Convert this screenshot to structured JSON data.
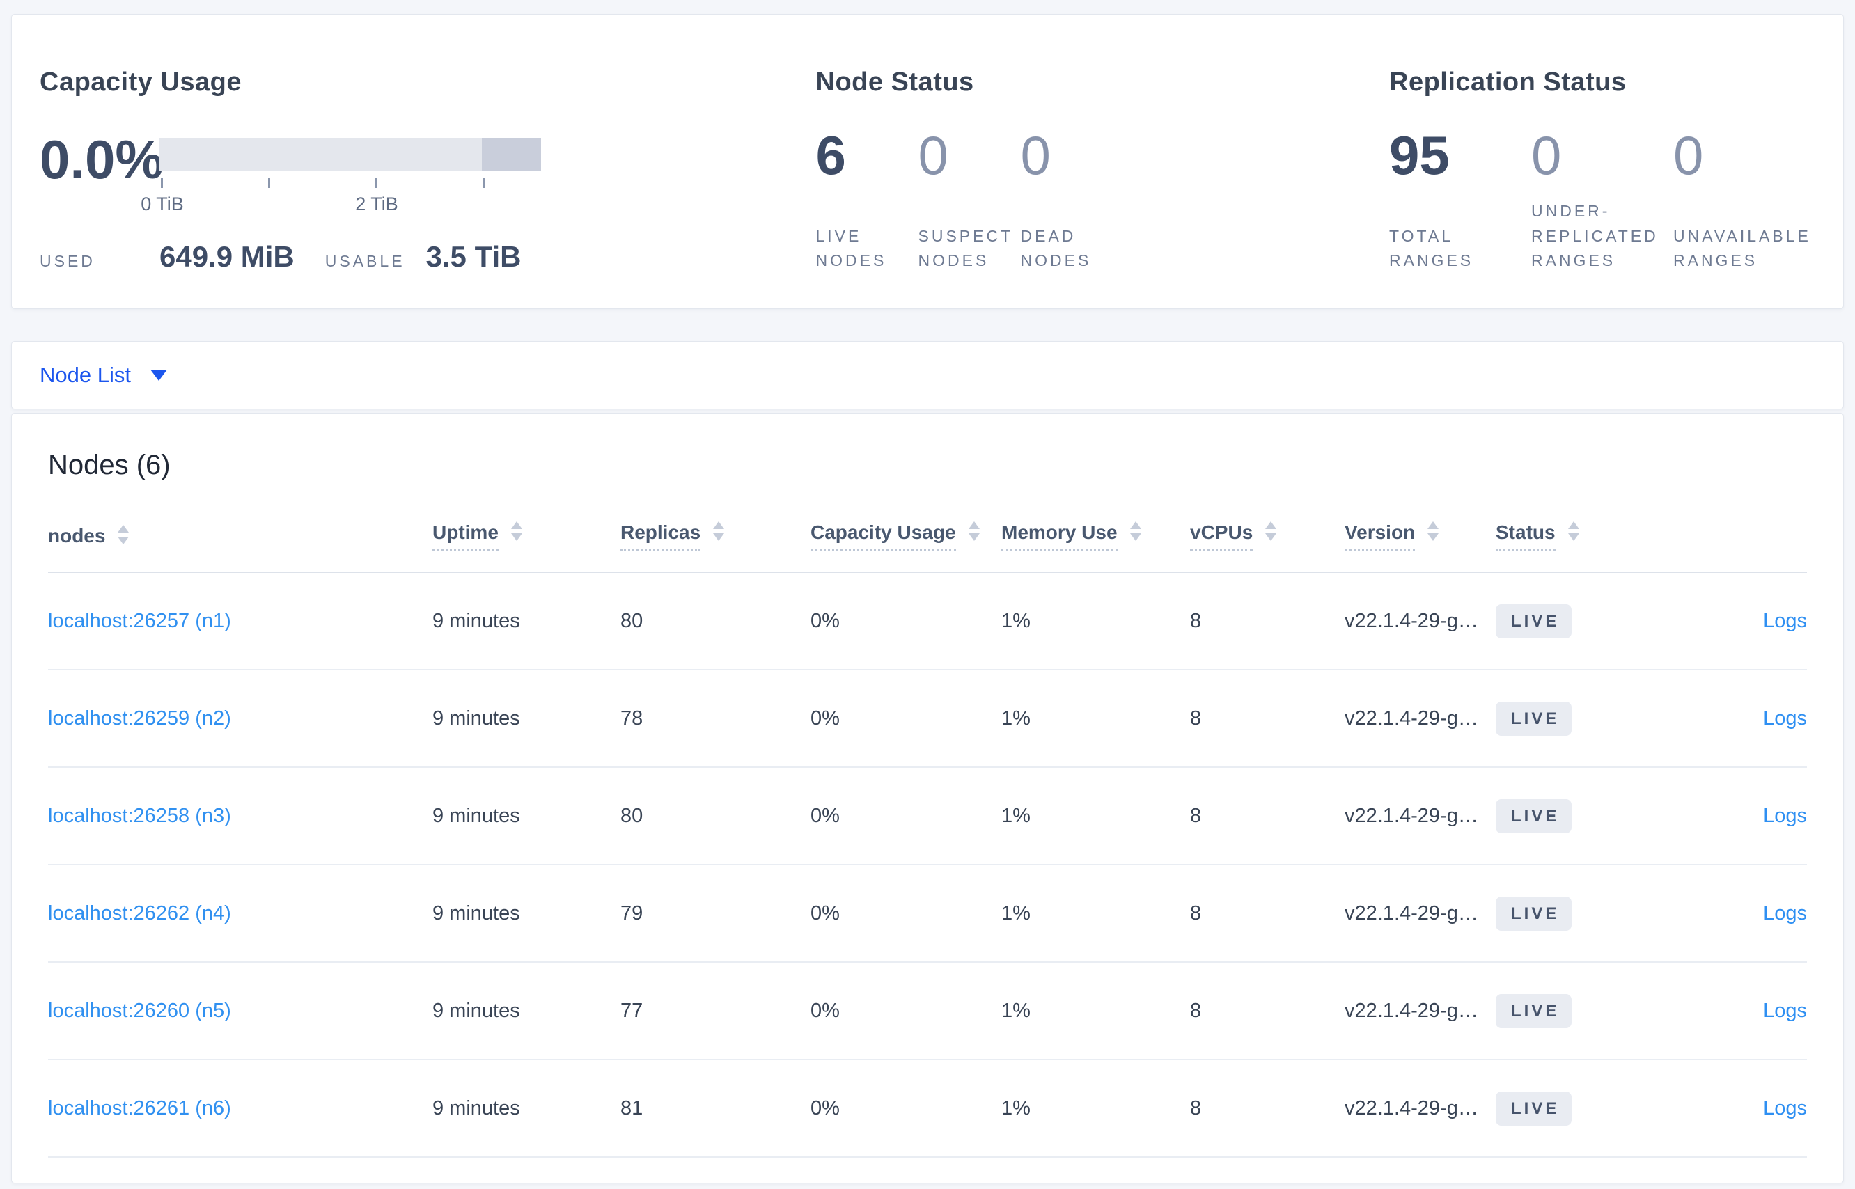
{
  "overview": {
    "capacity": {
      "title": "Capacity Usage",
      "percent": "0.0%",
      "axis_ticks": [
        "0 TiB",
        "2 TiB"
      ],
      "used_label": "USED",
      "used_value": "649.9 MiB",
      "usable_label": "USABLE",
      "usable_value": "3.5 TiB"
    },
    "node_status": {
      "title": "Node Status",
      "stats": [
        {
          "value": "6",
          "label": "LIVE NODES"
        },
        {
          "value": "0",
          "label": "SUSPECT NODES"
        },
        {
          "value": "0",
          "label": "DEAD NODES"
        }
      ]
    },
    "replication": {
      "title": "Replication Status",
      "stats": [
        {
          "value": "95",
          "label": "TOTAL RANGES"
        },
        {
          "value": "0",
          "label": "UNDER-REPLICATED RANGES"
        },
        {
          "value": "0",
          "label": "UNAVAILABLE RANGES"
        }
      ]
    }
  },
  "view_selector": {
    "label": "Node List"
  },
  "nodes_table": {
    "title": "Nodes (6)",
    "headers": [
      "nodes",
      "Uptime",
      "Replicas",
      "Capacity Usage",
      "Memory Use",
      "vCPUs",
      "Version",
      "Status"
    ],
    "logs_label": "Logs",
    "rows": [
      {
        "node": "localhost:26257 (n1)",
        "uptime": "9 minutes",
        "replicas": "80",
        "capacity": "0%",
        "memory": "1%",
        "vcpus": "8",
        "version": "v22.1.4-29-g…",
        "status": "LIVE"
      },
      {
        "node": "localhost:26259 (n2)",
        "uptime": "9 minutes",
        "replicas": "78",
        "capacity": "0%",
        "memory": "1%",
        "vcpus": "8",
        "version": "v22.1.4-29-g…",
        "status": "LIVE"
      },
      {
        "node": "localhost:26258 (n3)",
        "uptime": "9 minutes",
        "replicas": "80",
        "capacity": "0%",
        "memory": "1%",
        "vcpus": "8",
        "version": "v22.1.4-29-g…",
        "status": "LIVE"
      },
      {
        "node": "localhost:26262 (n4)",
        "uptime": "9 minutes",
        "replicas": "79",
        "capacity": "0%",
        "memory": "1%",
        "vcpus": "8",
        "version": "v22.1.4-29-g…",
        "status": "LIVE"
      },
      {
        "node": "localhost:26260 (n5)",
        "uptime": "9 minutes",
        "replicas": "77",
        "capacity": "0%",
        "memory": "1%",
        "vcpus": "8",
        "version": "v22.1.4-29-g…",
        "status": "LIVE"
      },
      {
        "node": "localhost:26261 (n6)",
        "uptime": "9 minutes",
        "replicas": "81",
        "capacity": "0%",
        "memory": "1%",
        "vcpus": "8",
        "version": "v22.1.4-29-g…",
        "status": "LIVE"
      }
    ]
  },
  "colors": {
    "page_background": "#f4f6fa",
    "primary_link_blue": "#1c56ee",
    "node_link_blue": "#3090f0",
    "dark_stat_text": "#3e4c66",
    "muted_stat_text": "#8893ab",
    "label_gray": "#6e7a92",
    "bar_light": "#e4e7ed",
    "bar_dark": "#c9cedb",
    "badge_background": "#e9ecf2",
    "badge_text": "#46536b"
  }
}
